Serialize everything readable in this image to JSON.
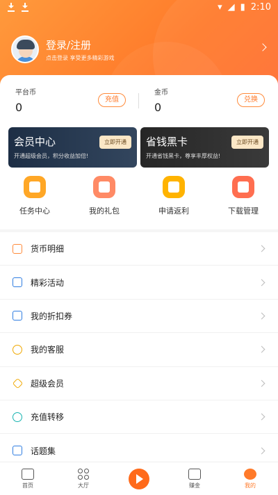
{
  "status_bar": {
    "time": "2:10"
  },
  "profile": {
    "title": "登录/注册",
    "subtitle": "点击登录 享受更多精彩游戏"
  },
  "balances": [
    {
      "label": "平台币",
      "value": "0",
      "button": "充值"
    },
    {
      "label": "金币",
      "value": "0",
      "button": "兑换"
    }
  ],
  "promos": [
    {
      "title": "会员中心",
      "subtitle": "开通超级会员，积分收益加倍!",
      "button": "立即开通"
    },
    {
      "title": "省钱黑卡",
      "subtitle": "开通省钱黑卡，尊享丰厚权益!",
      "button": "立即开通"
    }
  ],
  "shortcuts": [
    {
      "label": "任务中心",
      "icon": "task-icon"
    },
    {
      "label": "我的礼包",
      "icon": "gift-icon"
    },
    {
      "label": "申请返利",
      "icon": "rebate-icon"
    },
    {
      "label": "下载管理",
      "icon": "download-icon"
    }
  ],
  "menu": [
    {
      "label": "货币明细",
      "icon": "coin-stack-icon"
    },
    {
      "label": "精彩活动",
      "icon": "flag-icon"
    },
    {
      "label": "我的折扣券",
      "icon": "coupon-icon"
    },
    {
      "label": "我的客服",
      "icon": "chat-icon"
    },
    {
      "label": "超级会员",
      "icon": "diamond-icon"
    },
    {
      "label": "充值转移",
      "icon": "yen-icon"
    },
    {
      "label": "话题集",
      "icon": "layers-icon"
    }
  ],
  "tabbar": [
    {
      "label": "首页",
      "icon": "home-icon"
    },
    {
      "label": "大厅",
      "icon": "grid-icon"
    },
    {
      "label": "",
      "icon": "play-icon"
    },
    {
      "label": "赚金",
      "icon": "earn-icon"
    },
    {
      "label": "我的",
      "icon": "profile-icon"
    }
  ],
  "colors": {
    "accent": "#ff7a2a",
    "header_start": "#ff9a3c",
    "header_end": "#ff6a30"
  }
}
